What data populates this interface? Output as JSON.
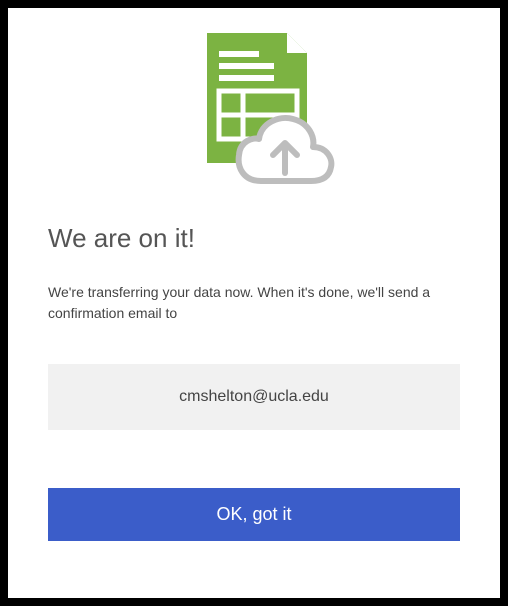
{
  "dialog": {
    "heading": "We are on it!",
    "body": "We're transferring your data now. When it's done, we'll send a confirmation email to",
    "email": "cmshelton@ucla.edu",
    "button_label": "OK, got it"
  }
}
